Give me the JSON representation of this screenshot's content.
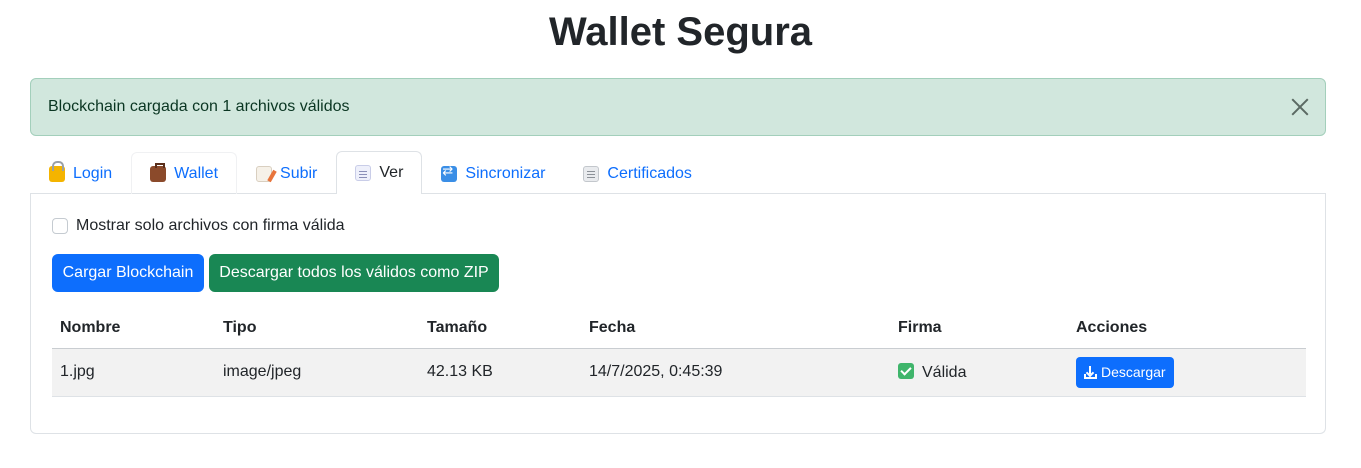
{
  "page": {
    "title": "Wallet Segura"
  },
  "alert": {
    "message": "Blockchain cargada con 1 archivos válidos"
  },
  "tabs": [
    {
      "label": "Login",
      "icon": "lock-icon"
    },
    {
      "label": "Wallet",
      "icon": "briefcase-icon"
    },
    {
      "label": "Subir",
      "icon": "memo-icon"
    },
    {
      "label": "Ver",
      "icon": "page-icon",
      "active": true
    },
    {
      "label": "Sincronizar",
      "icon": "sync-icon"
    },
    {
      "label": "Certificados",
      "icon": "receipt-icon"
    }
  ],
  "view": {
    "filter_label": "Mostrar solo archivos con firma válida",
    "filter_checked": false,
    "load_button": "Cargar Blockchain",
    "zip_button": "Descargar todos los válidos como ZIP"
  },
  "table": {
    "headers": [
      "Nombre",
      "Tipo",
      "Tamaño",
      "Fecha",
      "Firma",
      "Acciones"
    ],
    "rows": [
      {
        "name": "1.jpg",
        "type": "image/jpeg",
        "size": "42.13 KB",
        "date": "14/7/2025, 0:45:39",
        "signature": "Válida",
        "action": "Descargar"
      }
    ]
  },
  "colors": {
    "primary": "#0d6efd",
    "success": "#198754",
    "alert_bg": "#d1e7dd",
    "valid": "#3fb56b"
  }
}
